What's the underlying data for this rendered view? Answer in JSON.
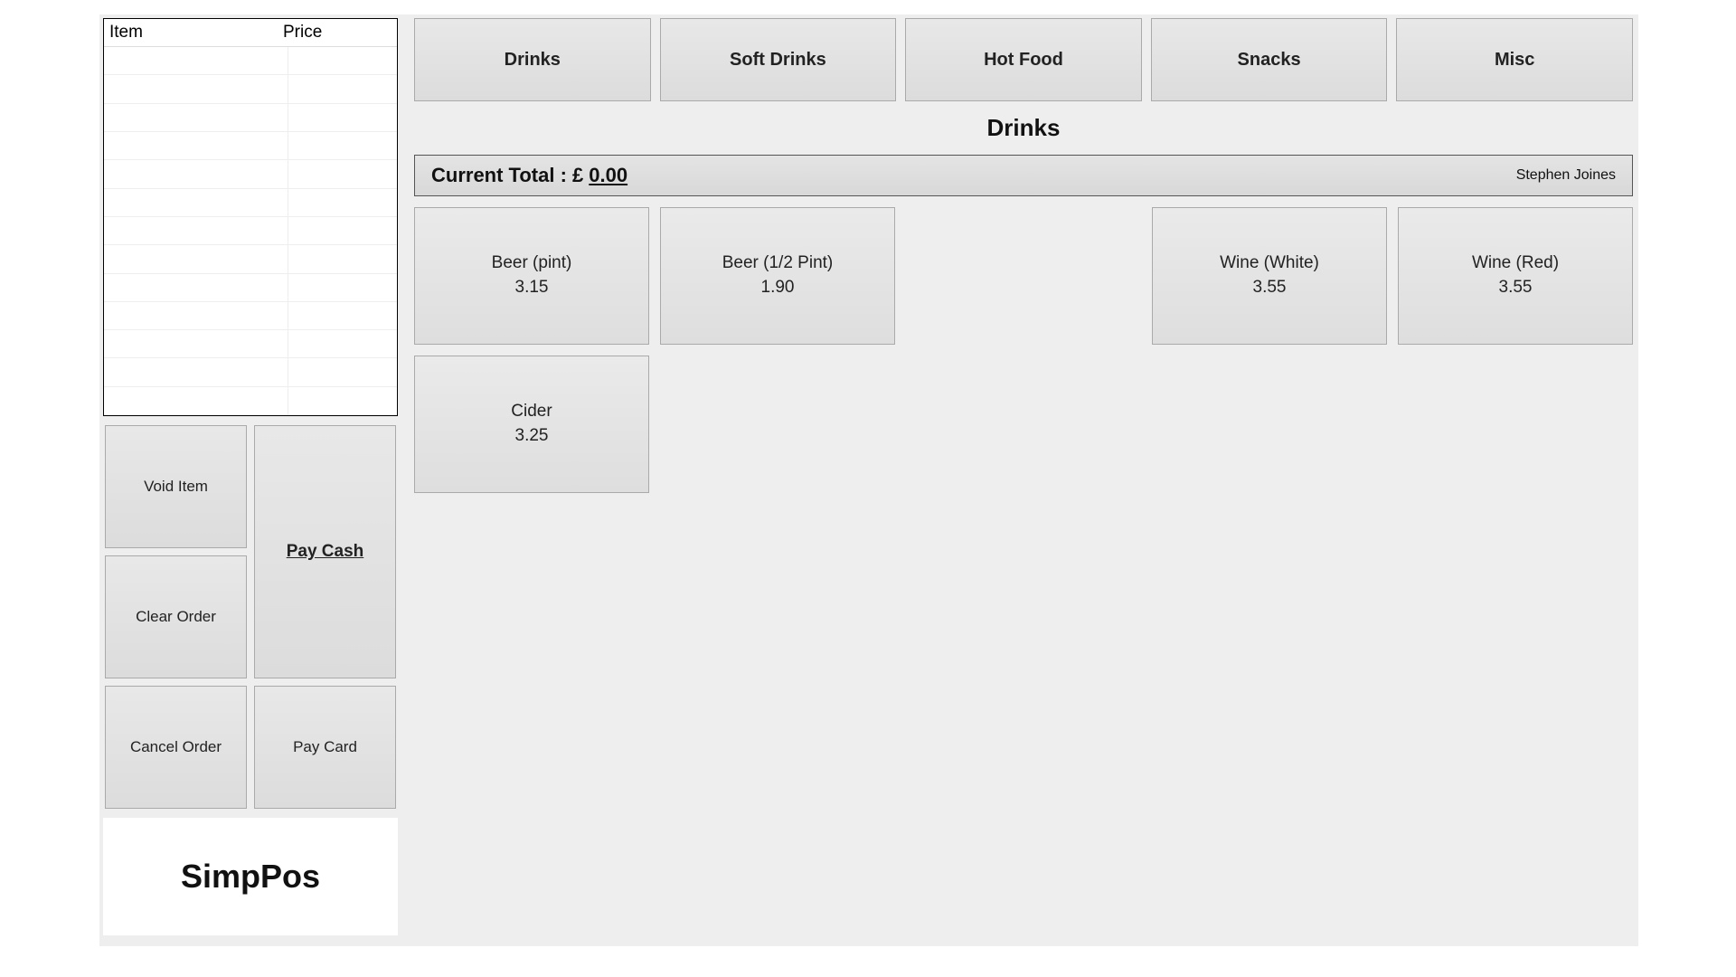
{
  "order_table": {
    "headers": {
      "item": "Item",
      "price": "Price"
    },
    "rows": 13
  },
  "actions": {
    "void_item": "Void Item",
    "clear_order": "Clear Order",
    "cancel_order": "Cancel Order",
    "pay_cash": "Pay Cash",
    "pay_card": "Pay Card"
  },
  "logo": "SimpPos",
  "categories": [
    "Drinks",
    "Soft Drinks",
    "Hot Food",
    "Snacks",
    "Misc"
  ],
  "active_category": "Drinks",
  "total_bar": {
    "label": "Current Total : £",
    "amount": "0.00",
    "user": "Stephen Joines"
  },
  "products": [
    {
      "name": "Beer (pint)",
      "price": "3.15",
      "col": 1,
      "row": 1
    },
    {
      "name": "Beer (1/2 Pint)",
      "price": "1.90",
      "col": 2,
      "row": 1
    },
    {
      "name": "Wine (White)",
      "price": "3.55",
      "col": 4,
      "row": 1
    },
    {
      "name": "Wine (Red)",
      "price": "3.55",
      "col": 5,
      "row": 1
    },
    {
      "name": "Cider",
      "price": "3.25",
      "col": 1,
      "row": 2
    }
  ]
}
